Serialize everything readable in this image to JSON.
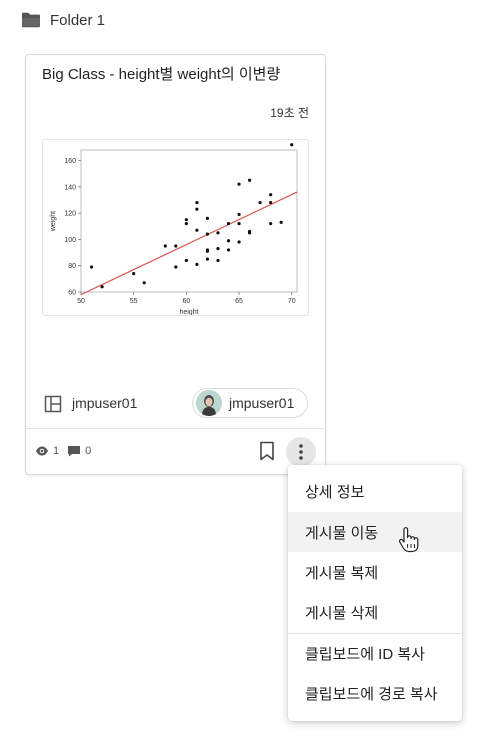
{
  "folder": {
    "name": "Folder 1",
    "icon": "folder-icon"
  },
  "card": {
    "title": "Big Class - height별 weight의 이변량",
    "time": "19초 전",
    "owner": "jmpuser01",
    "user_chip": "jmpuser01",
    "views": "1",
    "comments": "0"
  },
  "chart_data": {
    "type": "scatter",
    "xlabel": "height",
    "ylabel": "weight",
    "x_ticks": [
      "50",
      "55",
      "60",
      "65",
      "70"
    ],
    "y_ticks": [
      "60",
      "80",
      "100",
      "120",
      "140",
      "160"
    ],
    "xlim": [
      50,
      70.5
    ],
    "ylim": [
      60,
      168
    ],
    "points": [
      [
        51,
        79
      ],
      [
        52,
        64
      ],
      [
        55,
        74
      ],
      [
        56,
        67
      ],
      [
        58,
        95
      ],
      [
        59,
        79
      ],
      [
        59,
        95
      ],
      [
        60,
        84
      ],
      [
        60,
        112
      ],
      [
        60,
        115
      ],
      [
        61,
        81
      ],
      [
        61,
        107
      ],
      [
        61,
        123
      ],
      [
        61,
        128
      ],
      [
        62,
        85
      ],
      [
        62,
        91
      ],
      [
        62,
        92
      ],
      [
        62,
        104
      ],
      [
        62,
        116
      ],
      [
        63,
        84
      ],
      [
        63,
        93
      ],
      [
        63,
        105
      ],
      [
        64,
        92
      ],
      [
        64,
        99
      ],
      [
        64,
        112
      ],
      [
        65,
        98
      ],
      [
        65,
        112
      ],
      [
        65,
        119
      ],
      [
        65,
        142
      ],
      [
        66,
        105
      ],
      [
        66,
        106
      ],
      [
        66,
        145
      ],
      [
        67,
        128
      ],
      [
        68,
        112
      ],
      [
        68,
        128
      ],
      [
        68,
        134
      ],
      [
        69,
        113
      ],
      [
        70,
        172
      ]
    ],
    "fit_line": {
      "x": [
        50,
        70.5
      ],
      "y": [
        58,
        136
      ],
      "color": "#d9534f"
    },
    "grid": false
  },
  "menu": {
    "items": [
      {
        "label": "상세 정보"
      },
      {
        "label": "게시물 이동"
      },
      {
        "label": "게시물 복제"
      },
      {
        "label": "게시물 삭제"
      },
      {
        "label": "클립보드에 ID 복사"
      },
      {
        "label": "클립보드에 경로 복사"
      }
    ],
    "hovered_index": 1
  },
  "colors": {
    "fit_line": "#d9534f",
    "accent": "#555555"
  }
}
